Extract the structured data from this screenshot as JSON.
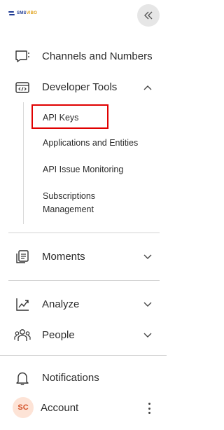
{
  "brand": {
    "logo_prefix": "SMS",
    "logo_accent": "VIBO",
    "primary_color": "#1f3a93",
    "accent_color": "#e0a21b"
  },
  "header": {
    "collapse_icon": "double-chevron-left-icon"
  },
  "nav": {
    "channels": {
      "label": "Channels and Numbers",
      "icon": "channels-icon"
    },
    "developer_tools": {
      "label": "Developer Tools",
      "icon": "code-window-icon",
      "expanded": true,
      "children": [
        {
          "label": "API Keys",
          "highlighted": true
        },
        {
          "label": "Applications and Entities"
        },
        {
          "label": "API Issue Monitoring"
        },
        {
          "label": "Subscriptions Management"
        }
      ]
    },
    "moments": {
      "label": "Moments",
      "icon": "moments-icon",
      "expanded": false
    },
    "analyze": {
      "label": "Analyze",
      "icon": "chart-trend-icon",
      "expanded": false
    },
    "people": {
      "label": "People",
      "icon": "people-icon",
      "expanded": false
    },
    "notifications": {
      "label": "Notifications",
      "icon": "bell-icon"
    },
    "account": {
      "label": "Account",
      "initials": "SC",
      "avatar_color": "#fde3d6"
    }
  },
  "highlight_color": "#e00000"
}
